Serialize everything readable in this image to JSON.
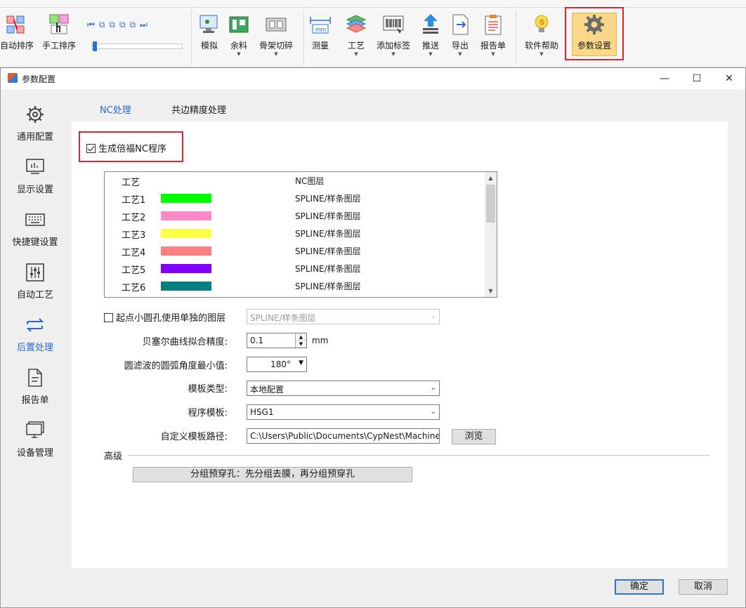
{
  "ribbon": {
    "auto_sort": "自动排序",
    "manual_sort": "手工排序",
    "simulate": "模拟",
    "remnant": "余料",
    "skeleton_cut": "骨架切碎",
    "measure": "测量",
    "process": "工艺",
    "add_label": "添加标签",
    "push": "推送",
    "export": "导出",
    "report": "报告单",
    "software_help": "软件帮助",
    "param_settings": "参数设置",
    "measure_unit": "mm"
  },
  "dialog": {
    "title": "参数配置",
    "minimize": "—",
    "maximize": "☐",
    "close": "✕"
  },
  "sidebar": {
    "items": [
      {
        "label": "通用配置",
        "icon": "gear-icon"
      },
      {
        "label": "显示设置",
        "icon": "display-icon"
      },
      {
        "label": "快捷键设置",
        "icon": "keyboard-icon"
      },
      {
        "label": "自动工艺",
        "icon": "sliders-icon"
      },
      {
        "label": "后置处理",
        "icon": "swap-arrows-icon"
      },
      {
        "label": "报告单",
        "icon": "document-icon"
      },
      {
        "label": "设备管理",
        "icon": "monitor-icon"
      }
    ],
    "active_index": 4
  },
  "tabs": [
    {
      "label": "NC处理",
      "active": true
    },
    {
      "label": "共边精度处理",
      "active": false
    }
  ],
  "nc": {
    "gen_multi_nc_label": "生成倍福NC程序",
    "gen_multi_nc_checked": true,
    "table": {
      "headers": [
        "工艺",
        "NC图层"
      ],
      "rows": [
        {
          "name": "工艺1",
          "color": "#00ff00",
          "layer": "SPLINE/样条图层"
        },
        {
          "name": "工艺2",
          "color": "#ff88c8",
          "layer": "SPLINE/样条图层"
        },
        {
          "name": "工艺3",
          "color": "#ffff44",
          "layer": "SPLINE/样条图层"
        },
        {
          "name": "工艺4",
          "color": "#ff8080",
          "layer": "SPLINE/样条图层"
        },
        {
          "name": "工艺5",
          "color": "#8000ff",
          "layer": "SPLINE/样条图层"
        },
        {
          "name": "工艺6",
          "color": "#008080",
          "layer": "SPLINE/样条图层"
        }
      ]
    },
    "small_hole_label": "起点小圆孔使用单独的图层",
    "small_hole_checked": false,
    "small_hole_layer": "SPLINE/样条图层",
    "bezier_label": "贝塞尔曲线拟合精度:",
    "bezier_value": "0.1",
    "bezier_unit": "mm",
    "arc_filter_label": "圆滤波的圆弧角度最小值:",
    "arc_filter_value": "180°",
    "template_type_label": "模板类型:",
    "template_type_value": "本地配置",
    "program_template_label": "程序模板:",
    "program_template_value": "HSG1",
    "custom_path_label": "自定义模板路径:",
    "custom_path_value": "C:\\Users\\Public\\Documents\\CypNest\\Machine",
    "browse_label": "浏览",
    "advanced_label": "高级",
    "group_prepierce_label": "分组预穿孔：先分组去膜，再分组预穿孔"
  },
  "footer": {
    "ok": "确定",
    "cancel": "取消"
  }
}
